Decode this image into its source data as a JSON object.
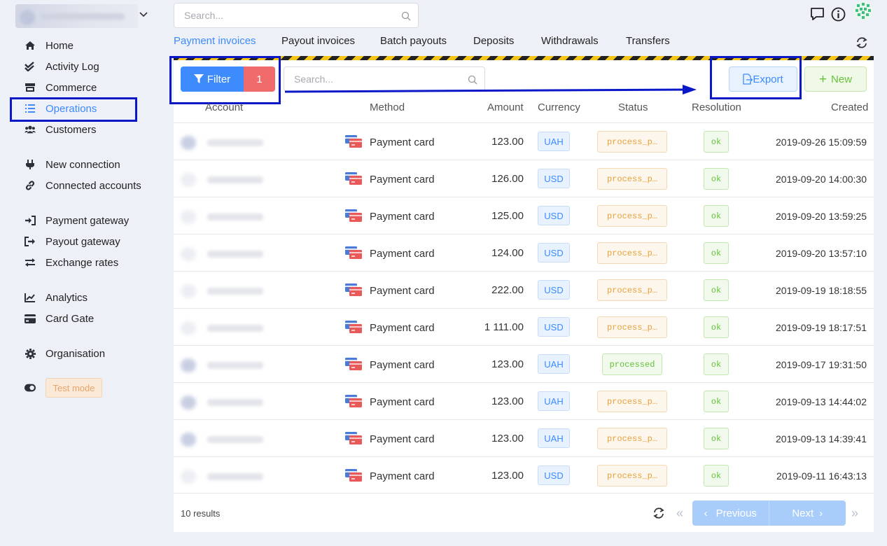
{
  "topbar": {
    "search_placeholder": "Search..."
  },
  "sidebar": {
    "items": [
      {
        "label": "Home",
        "icon": "home-icon"
      },
      {
        "label": "Activity Log",
        "icon": "double-check-icon"
      },
      {
        "label": "Commerce",
        "icon": "store-icon"
      },
      {
        "label": "Operations",
        "icon": "list-icon",
        "active": true
      },
      {
        "label": "Customers",
        "icon": "users-icon"
      },
      {
        "label": "New connection",
        "icon": "plug-icon"
      },
      {
        "label": "Connected accounts",
        "icon": "link-icon"
      },
      {
        "label": "Payment gateway",
        "icon": "sign-in-icon"
      },
      {
        "label": "Payout gateway",
        "icon": "sign-out-icon"
      },
      {
        "label": "Exchange rates",
        "icon": "exchange-icon"
      },
      {
        "label": "Analytics",
        "icon": "line-chart-icon"
      },
      {
        "label": "Card Gate",
        "icon": "credit-card-icon"
      },
      {
        "label": "Organisation",
        "icon": "gear-icon"
      }
    ],
    "test_mode_label": "Test mode"
  },
  "tabs": [
    {
      "label": "Payment invoices",
      "active": true
    },
    {
      "label": "Payout invoices"
    },
    {
      "label": "Batch payouts"
    },
    {
      "label": "Deposits"
    },
    {
      "label": "Withdrawals"
    },
    {
      "label": "Transfers"
    }
  ],
  "toolbar": {
    "filter_label": "Filter",
    "filter_count": "1",
    "search_placeholder": "Search...",
    "export_label": "Export",
    "new_label": "New"
  },
  "table": {
    "columns": [
      "Account",
      "Method",
      "Amount",
      "Currency",
      "Status",
      "Resolution",
      "Created"
    ],
    "rows": [
      {
        "method": "Payment card",
        "amount": "123.00",
        "currency": "UAH",
        "status": "process_p…",
        "status_type": "pending",
        "resolution": "ok",
        "created": "2019-09-26 15:09:59"
      },
      {
        "method": "Payment card",
        "amount": "126.00",
        "currency": "USD",
        "status": "process_p…",
        "status_type": "pending",
        "resolution": "ok",
        "created": "2019-09-20 14:00:30"
      },
      {
        "method": "Payment card",
        "amount": "125.00",
        "currency": "USD",
        "status": "process_p…",
        "status_type": "pending",
        "resolution": "ok",
        "created": "2019-09-20 13:59:25"
      },
      {
        "method": "Payment card",
        "amount": "124.00",
        "currency": "USD",
        "status": "process_p…",
        "status_type": "pending",
        "resolution": "ok",
        "created": "2019-09-20 13:57:10"
      },
      {
        "method": "Payment card",
        "amount": "222.00",
        "currency": "USD",
        "status": "process_p…",
        "status_type": "pending",
        "resolution": "ok",
        "created": "2019-09-19 18:18:55"
      },
      {
        "method": "Payment card",
        "amount": "1 111.00",
        "currency": "USD",
        "status": "process_p…",
        "status_type": "pending",
        "resolution": "ok",
        "created": "2019-09-19 18:17:51"
      },
      {
        "method": "Payment card",
        "amount": "123.00",
        "currency": "UAH",
        "status": "processed",
        "status_type": "done",
        "resolution": "ok",
        "created": "2019-09-17 19:31:50"
      },
      {
        "method": "Payment card",
        "amount": "123.00",
        "currency": "UAH",
        "status": "process_p…",
        "status_type": "pending",
        "resolution": "ok",
        "created": "2019-09-13 14:44:02"
      },
      {
        "method": "Payment card",
        "amount": "123.00",
        "currency": "UAH",
        "status": "process_p…",
        "status_type": "pending",
        "resolution": "ok",
        "created": "2019-09-13 14:39:41"
      },
      {
        "method": "Payment card",
        "amount": "123.00",
        "currency": "USD",
        "status": "process_p…",
        "status_type": "pending",
        "resolution": "ok",
        "created": "2019-09-11 16:43:13"
      }
    ]
  },
  "footer": {
    "results": "10 results",
    "previous_label": "Previous",
    "next_label": "Next"
  },
  "colors": {
    "accent": "#3d8bfd",
    "danger": "#f06b6b",
    "success": "#67c23a",
    "warning": "#e6a23c",
    "annotation": "#0a18c8"
  }
}
